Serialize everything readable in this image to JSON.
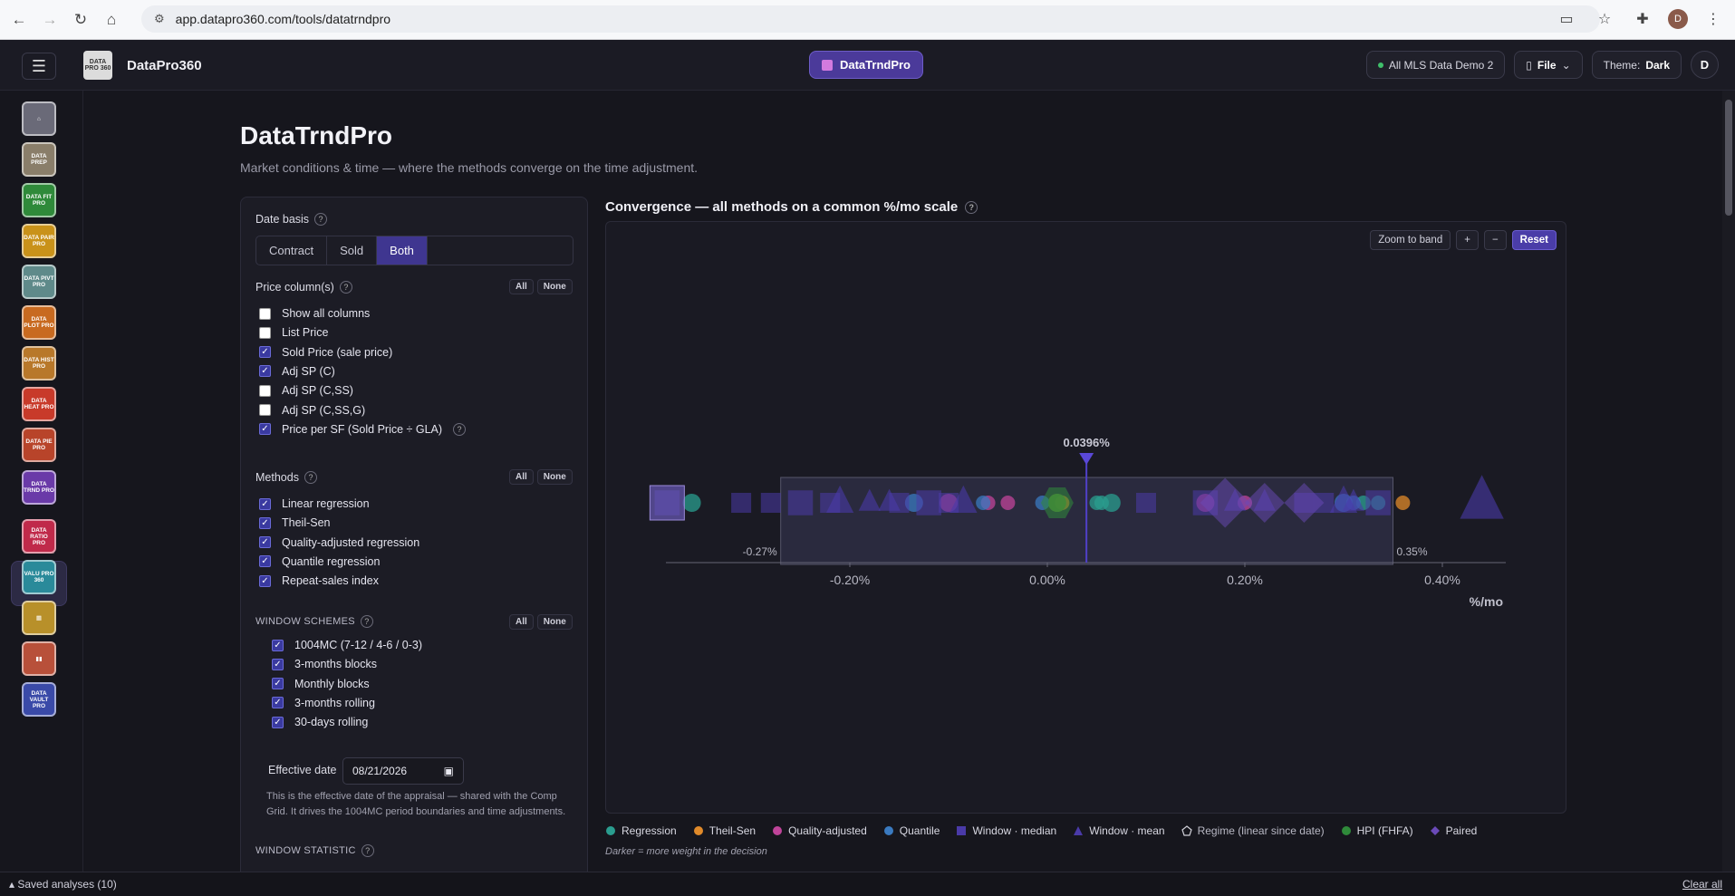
{
  "browser": {
    "url": "app.datapro360.com/tools/datatrndpro",
    "profile_initial": "D"
  },
  "header": {
    "brand": "DataPro360",
    "logo_text": "DATA PRO 360",
    "tool_name": "DataTrndPro",
    "dataset": "All MLS Data Demo 2",
    "file_label": "File",
    "theme_label": "Theme:",
    "theme_value": "Dark",
    "avatar": "D"
  },
  "sidebar": {
    "items": [
      {
        "name": "home",
        "text": "⌂",
        "color": "#6a6a78"
      },
      {
        "name": "dataprep",
        "text": "DATA PREP",
        "color": "#8a7e6a"
      },
      {
        "name": "datafitpro",
        "text": "DATA FIT PRO",
        "color": "#2f8a3a"
      },
      {
        "name": "datapairpro",
        "text": "DATA PAIR PRO",
        "color": "#c9921a"
      },
      {
        "name": "datapivtpro",
        "text": "DATA PIVT PRO",
        "color": "#5f8a8a"
      },
      {
        "name": "dataplotpro",
        "text": "DATA PLOT PRO",
        "color": "#c86a20"
      },
      {
        "name": "datahistpro",
        "text": "DATA HIST PRO",
        "color": "#b8782a"
      },
      {
        "name": "dataheatpro",
        "text": "DATA HEAT PRO",
        "color": "#c83a2a"
      },
      {
        "name": "datapiepro",
        "text": "DATA PIE PRO",
        "color": "#b8442a"
      },
      {
        "name": "datatrndpro",
        "text": "DATA TRND PRO",
        "color": "#6a3aa8"
      },
      {
        "name": "dataratiopro",
        "text": "DATA RATIO PRO",
        "color": "#c02a4a"
      },
      {
        "name": "valupro360",
        "text": "VALU PRO 360",
        "color": "#2a8a9a"
      },
      {
        "name": "compgrid",
        "text": "▦",
        "color": "#b8902a"
      },
      {
        "name": "reports",
        "text": "▮▮",
        "color": "#b8503a"
      },
      {
        "name": "datavaultpro",
        "text": "DATA VAULT PRO",
        "color": "#3a4aa8"
      }
    ]
  },
  "page": {
    "title": "DataTrndPro",
    "subtitle": "Market conditions & time — where the methods converge on the time adjustment."
  },
  "controls": {
    "date_basis_label": "Date basis",
    "date_basis_options": [
      "Contract",
      "Sold",
      "Both"
    ],
    "date_basis_selected": "Both",
    "price_columns_label": "Price column(s)",
    "all": "All",
    "none": "None",
    "price_columns": [
      {
        "label": "Show all columns",
        "checked": false
      },
      {
        "label": "List Price",
        "checked": false
      },
      {
        "label": "Sold Price (sale price)",
        "checked": true
      },
      {
        "label": "Adj SP (C)",
        "checked": true
      },
      {
        "label": "Adj SP (C,SS)",
        "checked": false
      },
      {
        "label": "Adj SP (C,SS,G)",
        "checked": false
      },
      {
        "label": "Price per SF (Sold Price ÷ GLA)",
        "checked": true
      }
    ],
    "methods_label": "Methods",
    "methods": [
      {
        "label": "Linear regression",
        "checked": true
      },
      {
        "label": "Theil-Sen",
        "checked": true
      },
      {
        "label": "Quality-adjusted regression",
        "checked": true
      },
      {
        "label": "Quantile regression",
        "checked": true
      },
      {
        "label": "Repeat-sales index",
        "checked": true
      }
    ],
    "window_schemes_label": "WINDOW SCHEMES",
    "window_schemes": [
      {
        "label": "1004MC (7-12 / 4-6 / 0-3)",
        "checked": true
      },
      {
        "label": "3-months blocks",
        "checked": true
      },
      {
        "label": "Monthly blocks",
        "checked": true
      },
      {
        "label": "3-months rolling",
        "checked": true
      },
      {
        "label": "30-days rolling",
        "checked": true
      }
    ],
    "effective_date_label": "Effective date",
    "effective_date": "08/21/2026",
    "effective_date_note": "This is the effective date of the appraisal — shared with the Comp Grid. It drives the 1004MC period boundaries and time adjustments.",
    "window_statistic_label": "WINDOW STATISTIC"
  },
  "chart": {
    "title": "Convergence — all methods on a common %/mo scale",
    "zoom_label": "Zoom to band",
    "plus": "+",
    "minus": "−",
    "reset": "Reset",
    "note": "Darker = more weight in the decision"
  },
  "chart_data": {
    "type": "scatter",
    "xlabel": "%/mo",
    "xlim": [
      -0.4,
      0.47
    ],
    "ticks": [
      {
        "v": -0.2,
        "label": "-0.20%"
      },
      {
        "v": 0.0,
        "label": "0.00%"
      },
      {
        "v": 0.2,
        "label": "0.20%"
      },
      {
        "v": 0.4,
        "label": "0.40%"
      }
    ],
    "decision": {
      "value": 0.0396,
      "label": "0.0396%"
    },
    "band": {
      "low": -0.27,
      "high": 0.35,
      "low_label": "-0.27%",
      "high_label": "0.35%"
    },
    "series": [
      {
        "name": "Regression",
        "color": "#2a9d8f",
        "shape": "circle",
        "values": [
          -0.36,
          0.05,
          0.055,
          0.065,
          0.32,
          0.335
        ]
      },
      {
        "name": "Theil-Sen",
        "color": "#e08a2a",
        "shape": "circle",
        "values": [
          0.01,
          0.015,
          0.36
        ]
      },
      {
        "name": "Quality-adjusted",
        "color": "#c0449a",
        "shape": "circle",
        "values": [
          -0.1,
          -0.06,
          -0.04,
          0.16,
          0.2
        ]
      },
      {
        "name": "Quantile",
        "color": "#3a7ac0",
        "shape": "circle",
        "values": [
          -0.135,
          -0.065,
          -0.005,
          0.3,
          0.31
        ]
      },
      {
        "name": "Window · median",
        "color": "#4a3aa8",
        "shape": "square",
        "values": [
          -0.385,
          -0.31,
          -0.28,
          -0.25,
          -0.22,
          -0.15,
          -0.12,
          -0.1,
          0.1,
          0.16,
          0.26,
          0.28,
          0.335
        ]
      },
      {
        "name": "Window · mean",
        "color": "#4a3aa8",
        "shape": "triangle",
        "values": [
          -0.21,
          -0.18,
          -0.16,
          -0.085,
          0.19,
          0.22,
          0.3,
          0.31,
          0.44
        ]
      },
      {
        "name": "Regime (linear since date)",
        "color": "#d0d0d8",
        "shape": "pentagon",
        "values": []
      },
      {
        "name": "HPI (FHFA)",
        "color": "#2f8a3a",
        "shape": "circle",
        "values": [
          0.01
        ]
      },
      {
        "name": "Paired",
        "color": "#6a4ab8",
        "shape": "diamond",
        "values": [
          0.18,
          0.22,
          0.26
        ]
      }
    ]
  },
  "footer": {
    "saved": "Saved analyses (10)",
    "clear": "Clear all"
  }
}
